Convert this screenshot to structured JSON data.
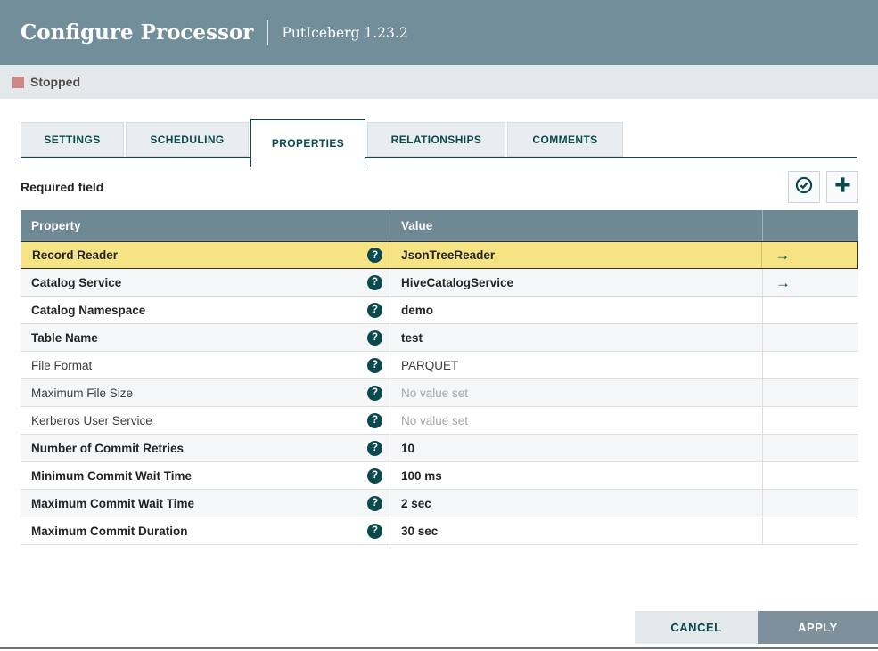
{
  "dialog": {
    "title": "Configure Processor",
    "subtitle": "PutIceberg 1.23.2"
  },
  "status": {
    "label": "Stopped",
    "indicator_color": "#D18686"
  },
  "tabs": [
    {
      "label": "SETTINGS",
      "active": false
    },
    {
      "label": "SCHEDULING",
      "active": false
    },
    {
      "label": "PROPERTIES",
      "active": true
    },
    {
      "label": "RELATIONSHIPS",
      "active": false
    },
    {
      "label": "COMMENTS",
      "active": false
    }
  ],
  "toolbar": {
    "required_label": "Required field",
    "verify_icon": "check-circle-icon",
    "add_icon": "plus-icon"
  },
  "table": {
    "columns": {
      "property": "Property",
      "value": "Value"
    },
    "help_icon": "question-mark-icon",
    "goto_icon": "right-arrow-icon",
    "goto_glyph": "→",
    "question_glyph": "?",
    "rows": [
      {
        "property": "Record Reader",
        "value": "JsonTreeReader",
        "required": true,
        "selected": true,
        "goto": true,
        "empty": false
      },
      {
        "property": "Catalog Service",
        "value": "HiveCatalogService",
        "required": true,
        "selected": false,
        "goto": true,
        "empty": false
      },
      {
        "property": "Catalog Namespace",
        "value": "demo",
        "required": true,
        "selected": false,
        "goto": false,
        "empty": false
      },
      {
        "property": "Table Name",
        "value": "test",
        "required": true,
        "selected": false,
        "goto": false,
        "empty": false
      },
      {
        "property": "File Format",
        "value": "PARQUET",
        "required": false,
        "selected": false,
        "goto": false,
        "empty": false
      },
      {
        "property": "Maximum File Size",
        "value": "No value set",
        "required": false,
        "selected": false,
        "goto": false,
        "empty": true
      },
      {
        "property": "Kerberos User Service",
        "value": "No value set",
        "required": false,
        "selected": false,
        "goto": false,
        "empty": true
      },
      {
        "property": "Number of Commit Retries",
        "value": "10",
        "required": true,
        "selected": false,
        "goto": false,
        "empty": false
      },
      {
        "property": "Minimum Commit Wait Time",
        "value": "100 ms",
        "required": true,
        "selected": false,
        "goto": false,
        "empty": false
      },
      {
        "property": "Maximum Commit Wait Time",
        "value": "2 sec",
        "required": true,
        "selected": false,
        "goto": false,
        "empty": false
      },
      {
        "property": "Maximum Commit Duration",
        "value": "30 sec",
        "required": true,
        "selected": false,
        "goto": false,
        "empty": false
      }
    ]
  },
  "footer": {
    "cancel_label": "CANCEL",
    "apply_label": "APPLY"
  },
  "colors": {
    "header_bg": "#728E9B",
    "status_bg": "#E3E8EB",
    "accent_teal": "#0A4A4F",
    "table_header_bg": "#6F8994",
    "selected_row_bg": "#F5E384",
    "alt_row_bg": "#F4F6F7",
    "apply_bg": "#7D909B"
  }
}
